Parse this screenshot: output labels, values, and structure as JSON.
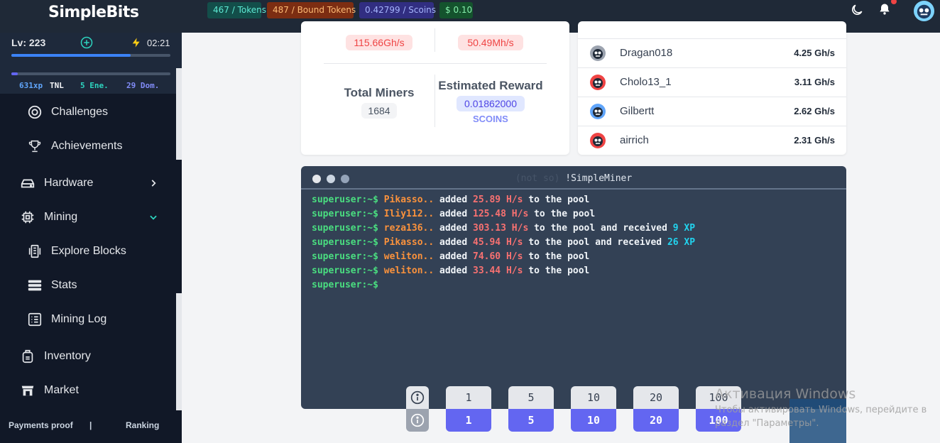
{
  "app": {
    "title": "SimpleBits"
  },
  "header": {
    "badges": {
      "tokens": "467 / Tokens",
      "bound": "487 / Bound Tokens",
      "scoins": "0.42799 / Scoins",
      "usd": "$ 0.10"
    }
  },
  "player": {
    "level": "Lv: 223",
    "timer": "02:21",
    "level_progress": 0.75,
    "energy_progress": 0.04,
    "xp": "631xp",
    "tnl": "TNL",
    "energy": "5 Ene.",
    "dom": "29 Dom."
  },
  "sidebar": {
    "items": [
      {
        "label": "Challenges"
      },
      {
        "label": "Achievements"
      },
      {
        "label": "Hardware"
      },
      {
        "label": "Mining"
      },
      {
        "label": "Explore Blocks"
      },
      {
        "label": "Stats"
      },
      {
        "label": "Mining Log"
      },
      {
        "label": "Inventory"
      },
      {
        "label": "Market"
      }
    ],
    "footer": {
      "left": "Payments proof",
      "sep": "|",
      "right": "Ranking"
    }
  },
  "pool": {
    "hash1": "115.66Gh/s",
    "hash2": "50.49Mh/s",
    "total_miners_label": "Total Miners",
    "total_miners": "1684",
    "reward_label": "Estimated Reward",
    "reward": "0.01862000",
    "reward_unit": "SCOINS"
  },
  "leaderboard": [
    {
      "name": "Dragan018",
      "rate": "4.25 Gh/s",
      "color": "#9ca3af"
    },
    {
      "name": "Cholo13_1",
      "rate": "3.11 Gh/s",
      "color": "#ef4444"
    },
    {
      "name": "Gilbertt",
      "rate": "2.62 Gh/s",
      "color": "#60a5fa"
    },
    {
      "name": "airrich",
      "rate": "2.31 Gh/s",
      "color": "#ef4444"
    }
  ],
  "terminal": {
    "title_dim": "(not so)",
    "title": "!SimpleMiner",
    "prompt": "superuser:~$",
    "lines": [
      {
        "user": "Pikasso..",
        "added": "added",
        "rate": "25.89 H/s",
        "rest": "to the pool",
        "received": "",
        "xp": ""
      },
      {
        "user": "Iliy112..",
        "added": "added",
        "rate": "125.48 H/s",
        "rest": "to the pool",
        "received": "",
        "xp": ""
      },
      {
        "user": "reza136..",
        "added": "added",
        "rate": "303.13 H/s",
        "rest": "to the pool and received",
        "received": "",
        "xp": "9 XP"
      },
      {
        "user": "Pikasso..",
        "added": "added",
        "rate": "45.94 H/s",
        "rest": "to the pool and received",
        "received": "",
        "xp": "26 XP"
      },
      {
        "user": "weliton..",
        "added": "added",
        "rate": "74.60 H/s",
        "rest": "to the pool",
        "received": "",
        "xp": ""
      },
      {
        "user": "weliton..",
        "added": "added",
        "rate": "33.44 H/s",
        "rest": "to the pool",
        "received": "",
        "xp": ""
      }
    ]
  },
  "amounts": [
    {
      "top": "1",
      "bottom": "1"
    },
    {
      "top": "5",
      "bottom": "5"
    },
    {
      "top": "10",
      "bottom": "10"
    },
    {
      "top": "20",
      "bottom": "20"
    },
    {
      "top": "100",
      "bottom": "100"
    }
  ],
  "watermark": {
    "title": "Активация Windows",
    "body": "Чтобы активировать Windows, перейдите в раздел \"Параметры\"."
  }
}
